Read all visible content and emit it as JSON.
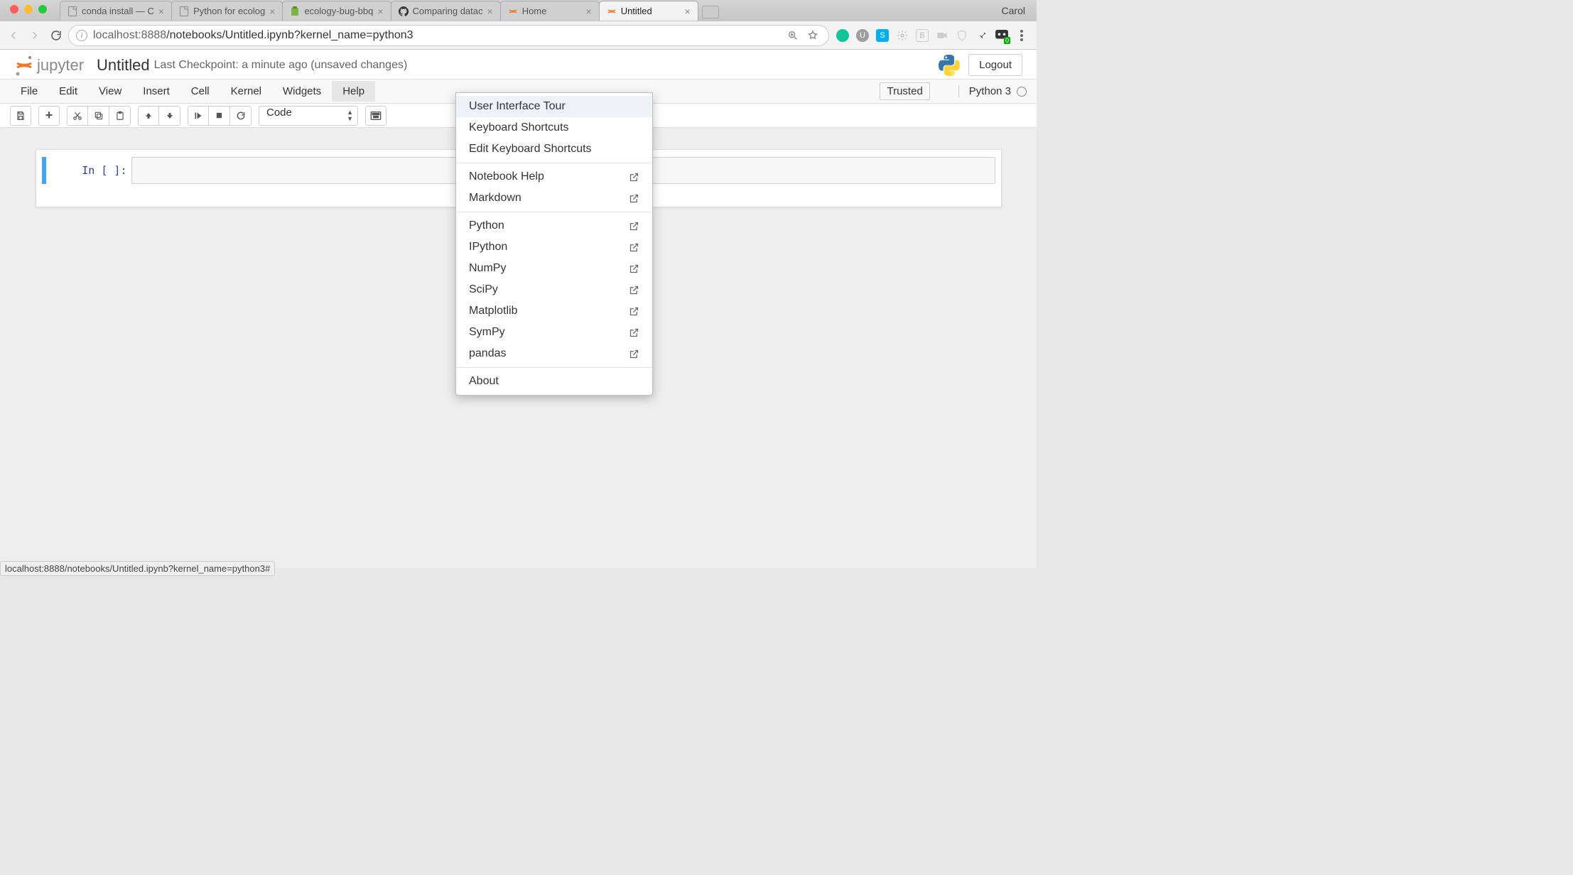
{
  "browser": {
    "profile": "Carol",
    "url_host": "localhost",
    "url_port": ":8888",
    "url_path": "/notebooks/Untitled.ipynb?kernel_name=python3",
    "tabs": [
      {
        "title": "conda install — C",
        "active": false,
        "icon": "page-icon"
      },
      {
        "title": "Python for ecolog",
        "active": false,
        "icon": "page-icon"
      },
      {
        "title": "ecology-bug-bbq",
        "active": false,
        "icon": "clipboard-icon"
      },
      {
        "title": "Comparing datac",
        "active": false,
        "icon": "github-icon"
      },
      {
        "title": "Home",
        "active": false,
        "icon": "jupyter-icon"
      },
      {
        "title": "Untitled",
        "active": true,
        "icon": "jupyter-icon"
      }
    ]
  },
  "header": {
    "logo_text": "jupyter",
    "nb_name": "Untitled",
    "checkpoint": "Last Checkpoint: a minute ago (unsaved changes)",
    "logout": "Logout"
  },
  "menubar": {
    "items": [
      "File",
      "Edit",
      "View",
      "Insert",
      "Cell",
      "Kernel",
      "Widgets",
      "Help"
    ],
    "open": "Help",
    "trusted": "Trusted",
    "kernel": "Python 3"
  },
  "toolbar": {
    "cell_type": "Code"
  },
  "dropdown": {
    "group1": [
      "User Interface Tour",
      "Keyboard Shortcuts",
      "Edit Keyboard Shortcuts"
    ],
    "group2": [
      "Notebook Help",
      "Markdown"
    ],
    "group3": [
      "Python",
      "IPython",
      "NumPy",
      "SciPy",
      "Matplotlib",
      "SymPy",
      "pandas"
    ],
    "group4": [
      "About"
    ]
  },
  "cell": {
    "prompt": "In [ ]:"
  },
  "status_bar": "localhost:8888/notebooks/Untitled.ipynb?kernel_name=python3#"
}
